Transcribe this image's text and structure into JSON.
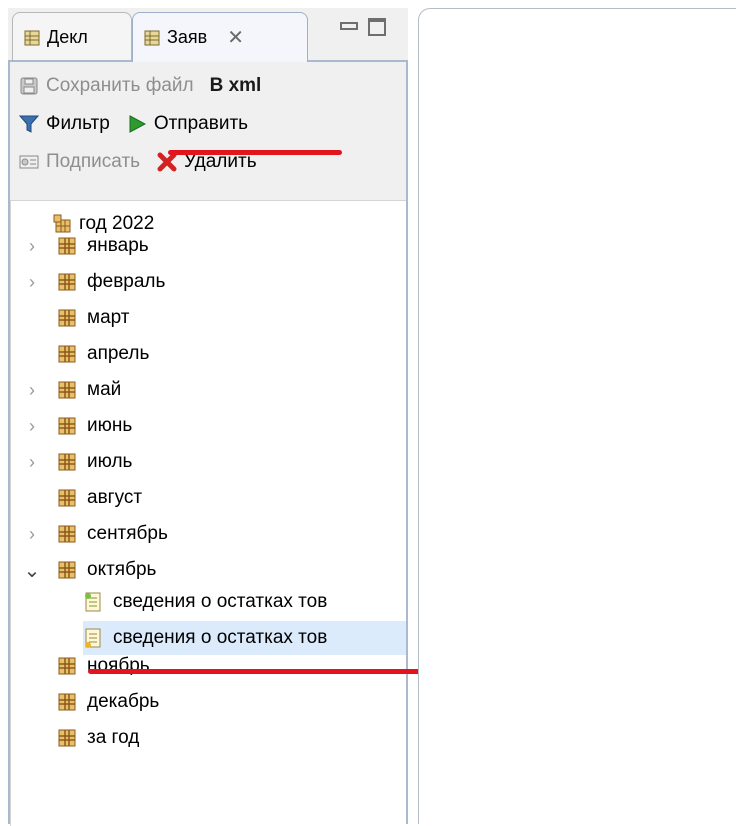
{
  "tabs": [
    {
      "label": "Декл"
    },
    {
      "label": "Заяв",
      "close": "✕"
    }
  ],
  "toolbar": {
    "save_label": "Сохранить файл",
    "xml_label": "В xml",
    "filter_label": "Фильтр",
    "send_label": "Отправить",
    "sign_label": "Подписать",
    "delete_label": "Удалить"
  },
  "tree": {
    "root": "год 2022",
    "months": [
      {
        "label": "январь",
        "expander": "›"
      },
      {
        "label": "февраль",
        "expander": "›"
      },
      {
        "label": "март",
        "expander": ""
      },
      {
        "label": "апрель",
        "expander": ""
      },
      {
        "label": "май",
        "expander": "›"
      },
      {
        "label": "июнь",
        "expander": "›"
      },
      {
        "label": "июль",
        "expander": "›"
      },
      {
        "label": "август",
        "expander": ""
      },
      {
        "label": "сентябрь",
        "expander": "›"
      },
      {
        "label": "октябрь",
        "expander": "⌄"
      }
    ],
    "october_children": [
      {
        "label": "сведения о остатках тов"
      },
      {
        "label": "сведения о остатках тов"
      }
    ],
    "after": [
      {
        "label": "ноябрь"
      },
      {
        "label": "декабрь"
      },
      {
        "label": "за год"
      }
    ]
  },
  "colors": {
    "highlight": "#e2151d",
    "selection": "#dcebfc",
    "send_icon": "#2e9b2e",
    "delete_icon": "#d32222"
  }
}
